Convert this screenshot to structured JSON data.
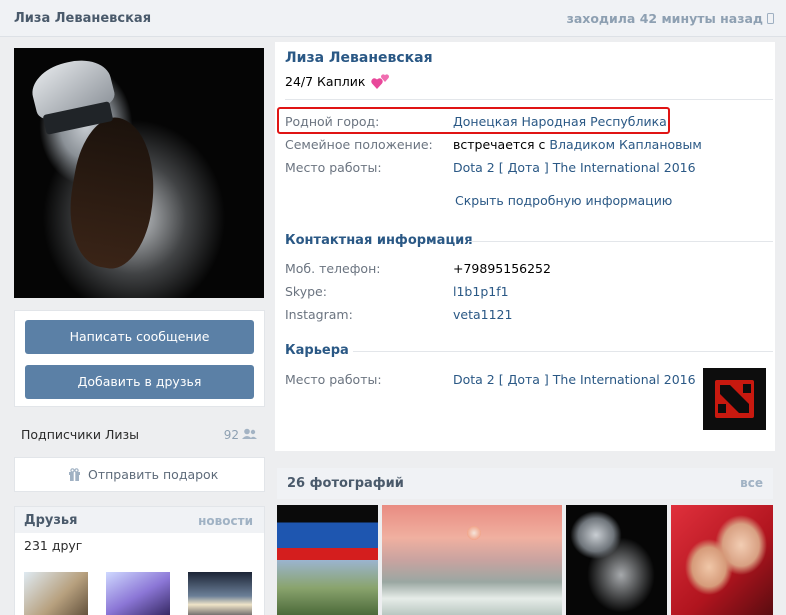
{
  "header": {
    "name": "Лиза Леваневская",
    "last_seen": "заходила 42 минуты назад"
  },
  "profile": {
    "name": "Лиза Леваневская",
    "status": "24/7 Каплик"
  },
  "info": [
    {
      "label": "Родной город:",
      "value": "Донецкая Народная Республика"
    },
    {
      "label": "Семейное положение:",
      "value_prefix": "встречается с ",
      "value_link": "Владиком Каплановым"
    },
    {
      "label": "Место работы:",
      "value": "Dota 2 [ Дота ] The International 2016"
    }
  ],
  "toggle_details": "Скрыть подробную информацию",
  "contacts": {
    "title": "Контактная информация",
    "rows": [
      {
        "label": "Моб. телефон:",
        "value": "+79895156252"
      },
      {
        "label": "Skype:",
        "value": "l1b1p1f1"
      },
      {
        "label": "Instagram:",
        "value": "veta1121"
      }
    ]
  },
  "career": {
    "title": "Карьера",
    "label": "Место работы:",
    "value": "Dota 2 [ Дота ] The International 2016"
  },
  "actions": {
    "message": "Написать сообщение",
    "add_friend": "Добавить в друзья",
    "gift": "Отправить подарок"
  },
  "followers": {
    "label": "Подписчики Лизы",
    "count": "92"
  },
  "friends": {
    "title": "Друзья",
    "link": "новости",
    "count": "231 друг"
  },
  "photos": {
    "title": "26 фотографий",
    "all": "все"
  },
  "colors": {
    "accent": "#2a5885",
    "button": "#5b80a6",
    "highlight": "#e01414"
  },
  "icons": {
    "phone": "phone-icon",
    "followers": "people-icon",
    "gift": "gift-icon",
    "heart": "hearts-icon",
    "dota": "dota-logo-icon"
  }
}
